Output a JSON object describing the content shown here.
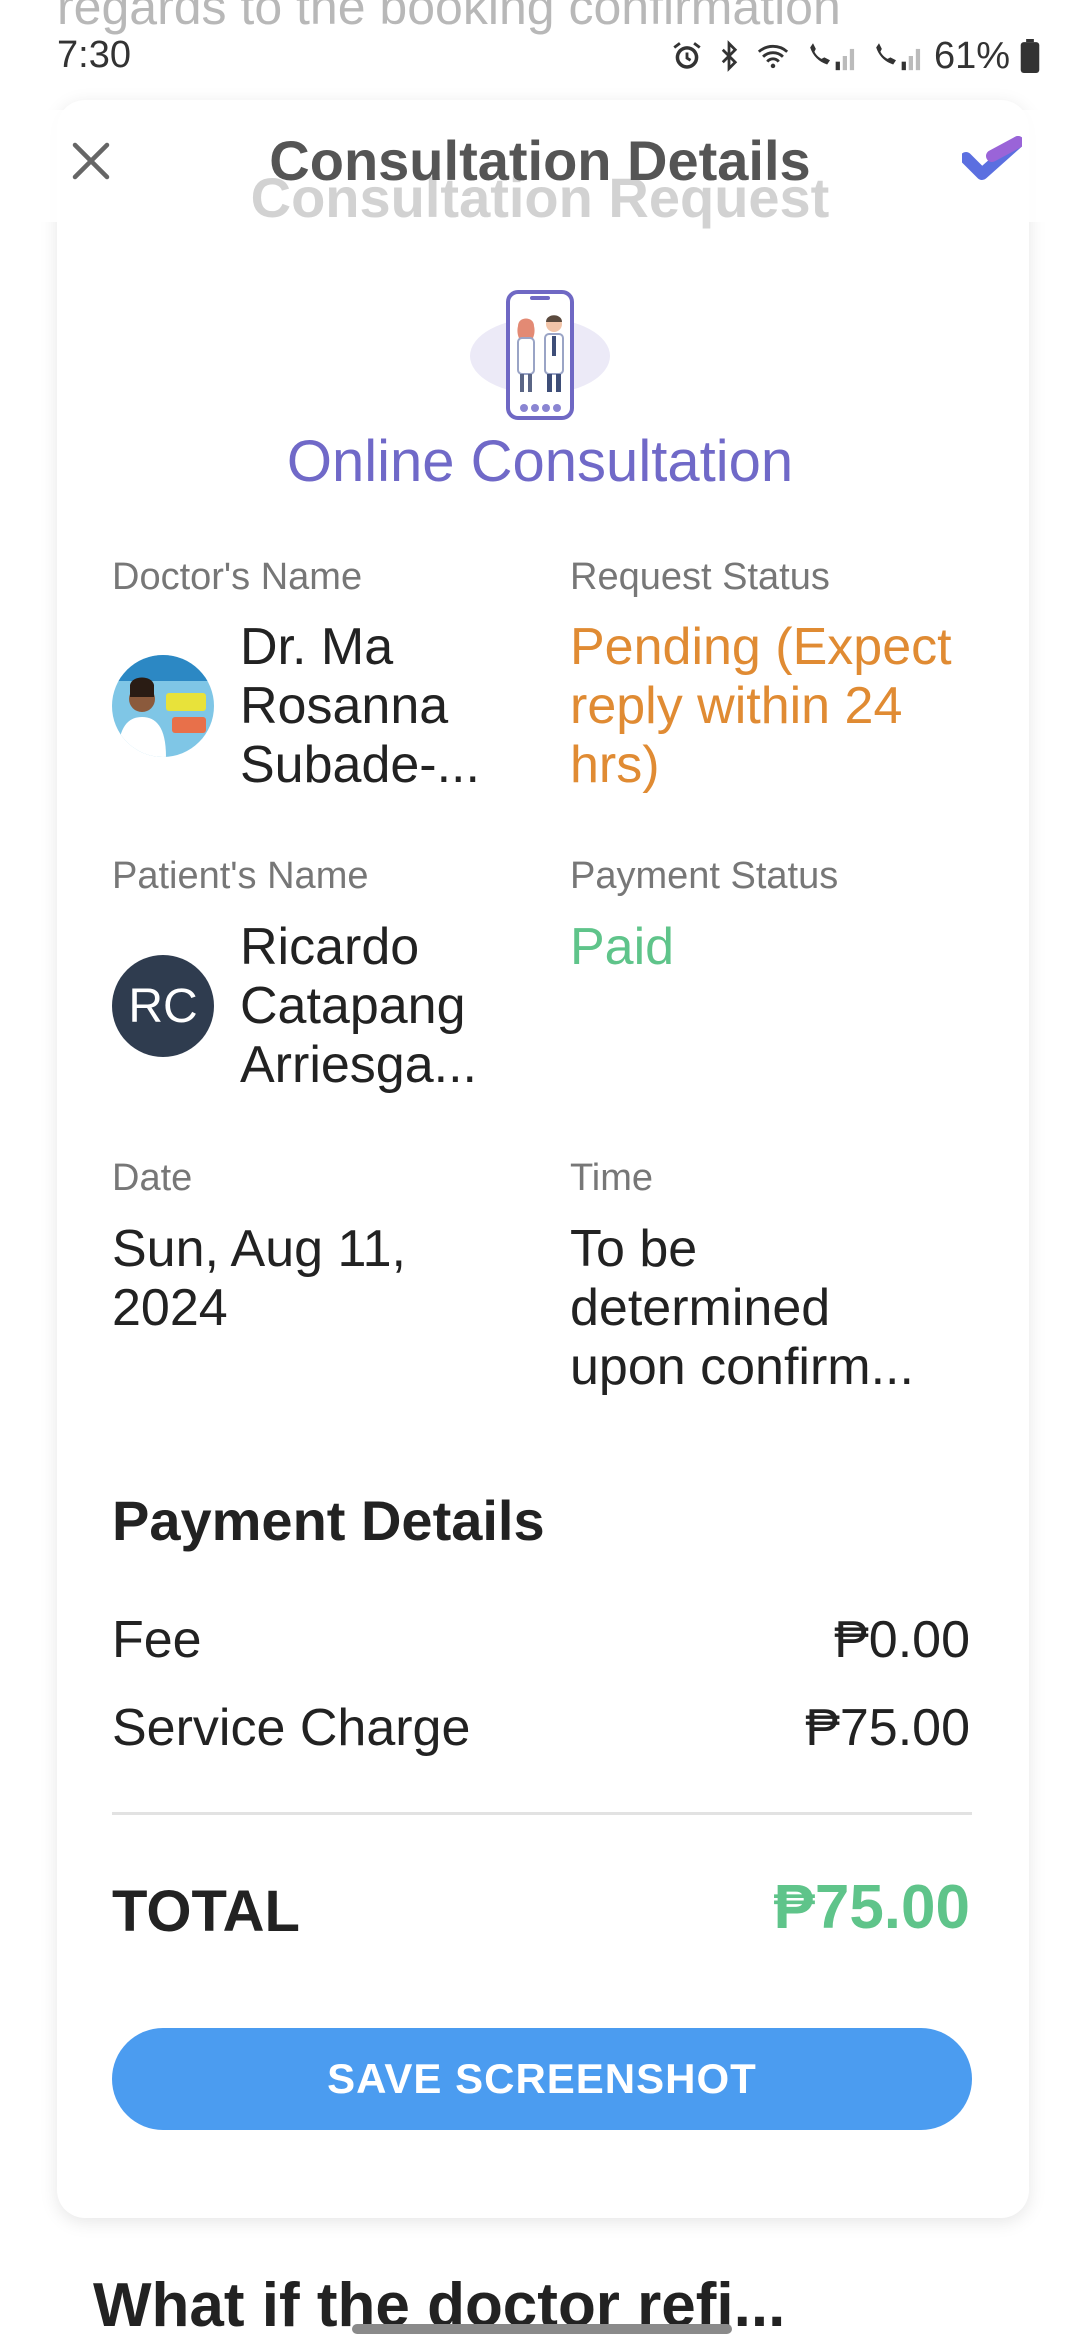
{
  "status_bar": {
    "time": "7:30",
    "battery": "61%"
  },
  "background": {
    "top_text": "regards to the booking confirmation",
    "bottom_text": "What if the doctor refi..."
  },
  "header": {
    "title": "Consultation Details",
    "ghost_title": "Consultation Request",
    "close_icon": "close-icon",
    "check_icon": "heart-check-icon"
  },
  "consultation": {
    "type_label": "Online Consultation",
    "accent_color": "#7069c8"
  },
  "details": {
    "doctor": {
      "label": "Doctor's Name",
      "name_lines": [
        "Dr. Ma",
        "Rosanna",
        "Subade-..."
      ]
    },
    "request_status": {
      "label": "Request Status",
      "lines": [
        "Pending (Expect",
        "reply within 24",
        "hrs)"
      ],
      "color": "#e08b33"
    },
    "patient": {
      "label": "Patient's Name",
      "initials": "RC",
      "name_lines": [
        "Ricardo",
        "Catapang",
        "Arriesga..."
      ]
    },
    "payment_status": {
      "label": "Payment Status",
      "value": "Paid",
      "color": "#5fc48a"
    },
    "date": {
      "label": "Date",
      "lines": [
        "Sun, Aug 11,",
        "2024"
      ]
    },
    "time": {
      "label": "Time",
      "lines": [
        "To be",
        "determined",
        "upon confirm..."
      ]
    }
  },
  "payment": {
    "title": "Payment Details",
    "rows": [
      {
        "label": "Fee",
        "value": "₱0.00"
      },
      {
        "label": "Service Charge",
        "value": "₱75.00"
      }
    ],
    "total_label": "TOTAL",
    "total_value": "₱75.00",
    "total_color": "#5fc48a"
  },
  "actions": {
    "save_label": "SAVE SCREENSHOT",
    "button_color": "#4b9cf0"
  }
}
